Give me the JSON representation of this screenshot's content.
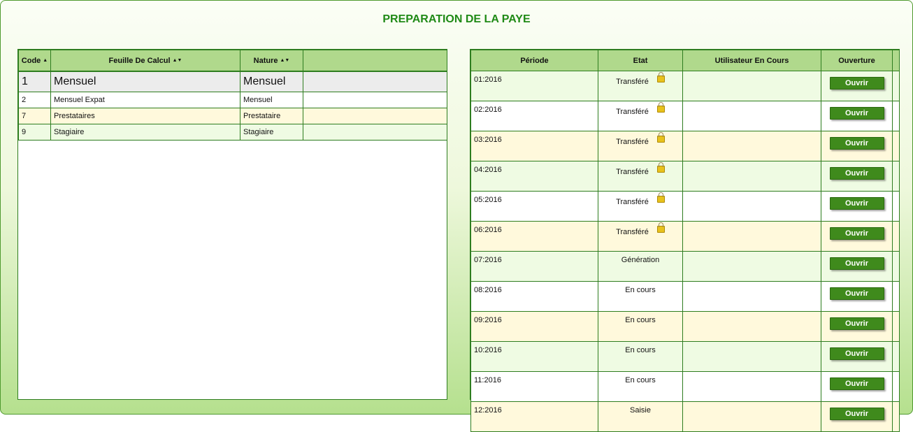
{
  "page": {
    "title": "PREPARATION DE LA PAYE"
  },
  "left_table": {
    "headers": {
      "code": "Code",
      "sheet": "Feuille De Calcul",
      "nature": "Nature"
    },
    "rows": [
      {
        "code": "1",
        "sheet": "Mensuel",
        "nature": "Mensuel"
      },
      {
        "code": "2",
        "sheet": "Mensuel Expat",
        "nature": "Mensuel"
      },
      {
        "code": "7",
        "sheet": "Prestataires",
        "nature": "Prestataire"
      },
      {
        "code": "9",
        "sheet": "Stagiaire",
        "nature": "Stagiaire"
      }
    ]
  },
  "right_table": {
    "headers": {
      "period": "Période",
      "state": "Etat",
      "user": "Utilisateur En Cours",
      "opening": "Ouverture"
    },
    "button_label": "Ouvrir",
    "rows": [
      {
        "period": "01:2016",
        "state": "Transféré",
        "user": "",
        "locked": true
      },
      {
        "period": "02:2016",
        "state": "Transféré",
        "user": "",
        "locked": true
      },
      {
        "period": "03:2016",
        "state": "Transféré",
        "user": "",
        "locked": true
      },
      {
        "period": "04:2016",
        "state": "Transféré",
        "user": "",
        "locked": true
      },
      {
        "period": "05:2016",
        "state": "Transféré",
        "user": "",
        "locked": true
      },
      {
        "period": "06:2016",
        "state": "Transféré",
        "user": "",
        "locked": true
      },
      {
        "period": "07:2016",
        "state": "Génération",
        "user": "",
        "locked": false
      },
      {
        "period": "08:2016",
        "state": "En cours",
        "user": "",
        "locked": false
      },
      {
        "period": "09:2016",
        "state": "En cours",
        "user": "",
        "locked": false
      },
      {
        "period": "10:2016",
        "state": "En cours",
        "user": "",
        "locked": false
      },
      {
        "period": "11:2016",
        "state": "En cours",
        "user": "",
        "locked": false
      },
      {
        "period": "12:2016",
        "state": "Saisie",
        "user": "",
        "locked": false
      }
    ]
  },
  "icons": {
    "lock": "lock-icon",
    "sort_asc": "sort-asc-icon",
    "sort_both": "sort-both-icon"
  },
  "colors": {
    "accent": "#1f8a16",
    "header_bg": "#b0d98c",
    "button_bg": "#3f8a1c"
  }
}
